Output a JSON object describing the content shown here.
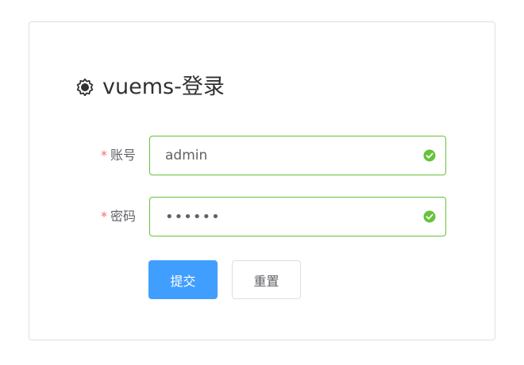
{
  "login": {
    "title": "vuems-登录",
    "title_icon": "gear-icon",
    "fields": {
      "account": {
        "required_mark": "*",
        "label": "账号",
        "value": "admin",
        "status_icon": "check-circle-icon"
      },
      "password": {
        "required_mark": "*",
        "label": "密码",
        "value": "123456",
        "status_icon": "check-circle-icon"
      }
    },
    "buttons": {
      "submit_label": "提交",
      "reset_label": "重置"
    },
    "colors": {
      "primary": "#409eff",
      "success": "#67c23a",
      "required": "#f56c6c",
      "border": "#dcdfe6"
    }
  }
}
